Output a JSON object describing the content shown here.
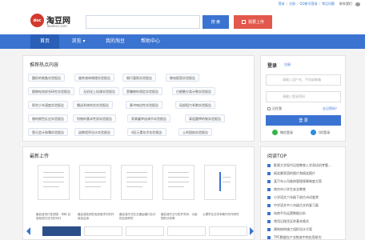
{
  "top": {
    "links": [
      "登录",
      "注册",
      "QQ账号登录",
      "常见问题"
    ],
    "contact": "联系我们",
    "wechat_icon": "wechat-icon"
  },
  "logo": {
    "badge": "doc",
    "name": "淘豆网",
    "url": "Taodocs.com"
  },
  "search": {
    "placeholder": "",
    "button": "搜 索"
  },
  "upload": {
    "label": "我要上传"
  },
  "nav": [
    "首页",
    "浏览 ▾",
    "我的淘豆",
    "帮助中心"
  ],
  "hot": {
    "title": "推荐热点内容",
    "tags": [
      "酸奶的制备实验报告",
      "旋转液体物理实验报告",
      "钢尺量距实验报告",
      "做电报案实验报告",
      "植物电池综合研究实验报告",
      "无机化上机课实验报告",
      "蔗糖物的测定实验报告",
      "白细胞分类计数实验报告",
      "探究小车速度实验报告",
      "播送系统的实实验报告",
      "脉冲响应性实验报告",
      "局部阻力系数实验报告",
      "物的颜色反应实验报告",
      "钧物的基本性质实验报告",
      "家禽屠宰选调节实验报告",
      "高锰酸钾的制实验报告",
      "登记会计账簿实验报告",
      "函数程序设计实验报告",
      "d区元素化学实验报告",
      "土的固结实验报告"
    ]
  },
  "login": {
    "title": "登录",
    "register": "注册",
    "user_placeholder": "请输入用户名、手机或邮箱",
    "pass_placeholder": "请输入登录密码",
    "remember": "记住我",
    "forgot": "忘记密码？",
    "button": "登 录",
    "wechat": "微信登录",
    "qq": "QQ登录"
  },
  "latest": {
    "title": "最新上传",
    "docs": [
      "截血液流行性调查：号称 目前检测方法中的可行",
      "截血液检测在临床医学中的作用及应用",
      "截血液疗法在交通运输行业中的应用研究",
      "截血液疗法与防护关系：污染物的分析等",
      "心理学论文学术期刊写作研究"
    ]
  },
  "rank": {
    "title": "阅读TOP",
    "items": [
      "影视大学现代远程教育入学测试机考题...",
      "搞笑搬家团的图片和搞笑图片",
      "某汽车公司维修管理规章制度方案",
      "南京市小学生安全教育",
      "小学语文六年级下册古诗词鉴赏",
      "中学语文中二年级古文的复习复",
      "电商平台运营数据分析",
      "常用记账凭证的基本格式",
      "建筑结构施工组织设计方案",
      "TPC数据在产业物流中的应用研究"
    ]
  }
}
